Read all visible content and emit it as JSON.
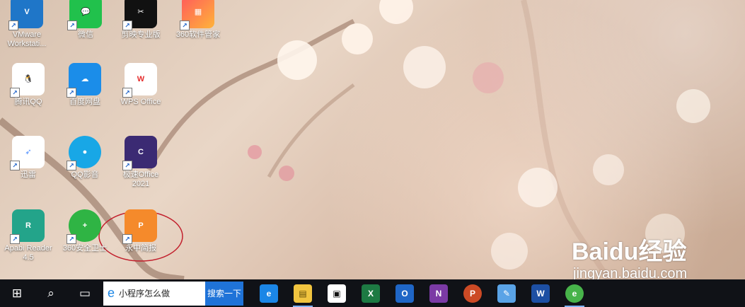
{
  "desktop": {
    "icons": [
      {
        "label": "VMware Workstati...",
        "color": "#1f76c8",
        "glyph": "V"
      },
      {
        "label": "微信",
        "color": "#21c14c",
        "glyph": "💬"
      },
      {
        "label": "剪映专业版",
        "color": "#111111",
        "glyph": "✂"
      },
      {
        "label": "360软件管家",
        "color": "#ff6b2d",
        "glyph": "▦"
      },
      {
        "label": "腾讯QQ",
        "color": "#111111",
        "glyph": "🐧"
      },
      {
        "label": "百度网盘",
        "color": "#1b8de9",
        "glyph": "☁"
      },
      {
        "label": "WPS Office",
        "color": "#e52d2d",
        "glyph": "W"
      },
      {
        "label": "迅雷",
        "color": "#4c8dff",
        "glyph": "➶"
      },
      {
        "label": "QQ影音",
        "color": "#18a7e6",
        "glyph": "●"
      },
      {
        "label": "极速Office 2021",
        "color": "#3b2a73",
        "glyph": "C"
      },
      {
        "label": "Apabi Reader 4.5",
        "color": "#23a48a",
        "glyph": "R"
      },
      {
        "label": "360安全卫士",
        "color": "#2fb444",
        "glyph": "+"
      },
      {
        "label": "永中简报",
        "color": "#f58a2b",
        "glyph": "P"
      }
    ]
  },
  "taskbar": {
    "search_text": "小程序怎么做",
    "search_button": "搜索一下",
    "apps": [
      {
        "name": "edge",
        "glyph": "e",
        "color": "#1b86e6"
      },
      {
        "name": "file-explorer",
        "glyph": "▤",
        "color": "#f1c43f"
      },
      {
        "name": "store",
        "glyph": "▣",
        "color": "#ffffff"
      },
      {
        "name": "excel",
        "glyph": "X",
        "color": "#1d7a43"
      },
      {
        "name": "outlook",
        "glyph": "O",
        "color": "#1f66c6"
      },
      {
        "name": "onenote",
        "glyph": "N",
        "color": "#7b3aa5"
      },
      {
        "name": "powerpoint",
        "glyph": "P",
        "color": "#cc4a25"
      },
      {
        "name": "paint",
        "glyph": "✎",
        "color": "#5aa3e6"
      },
      {
        "name": "word",
        "glyph": "W",
        "color": "#1d4fa3"
      },
      {
        "name": "360-browser",
        "glyph": "e",
        "color": "#47b34a"
      }
    ]
  },
  "watermark": {
    "brand": "Baidu经验",
    "url": "jingyan.baidu.com"
  }
}
